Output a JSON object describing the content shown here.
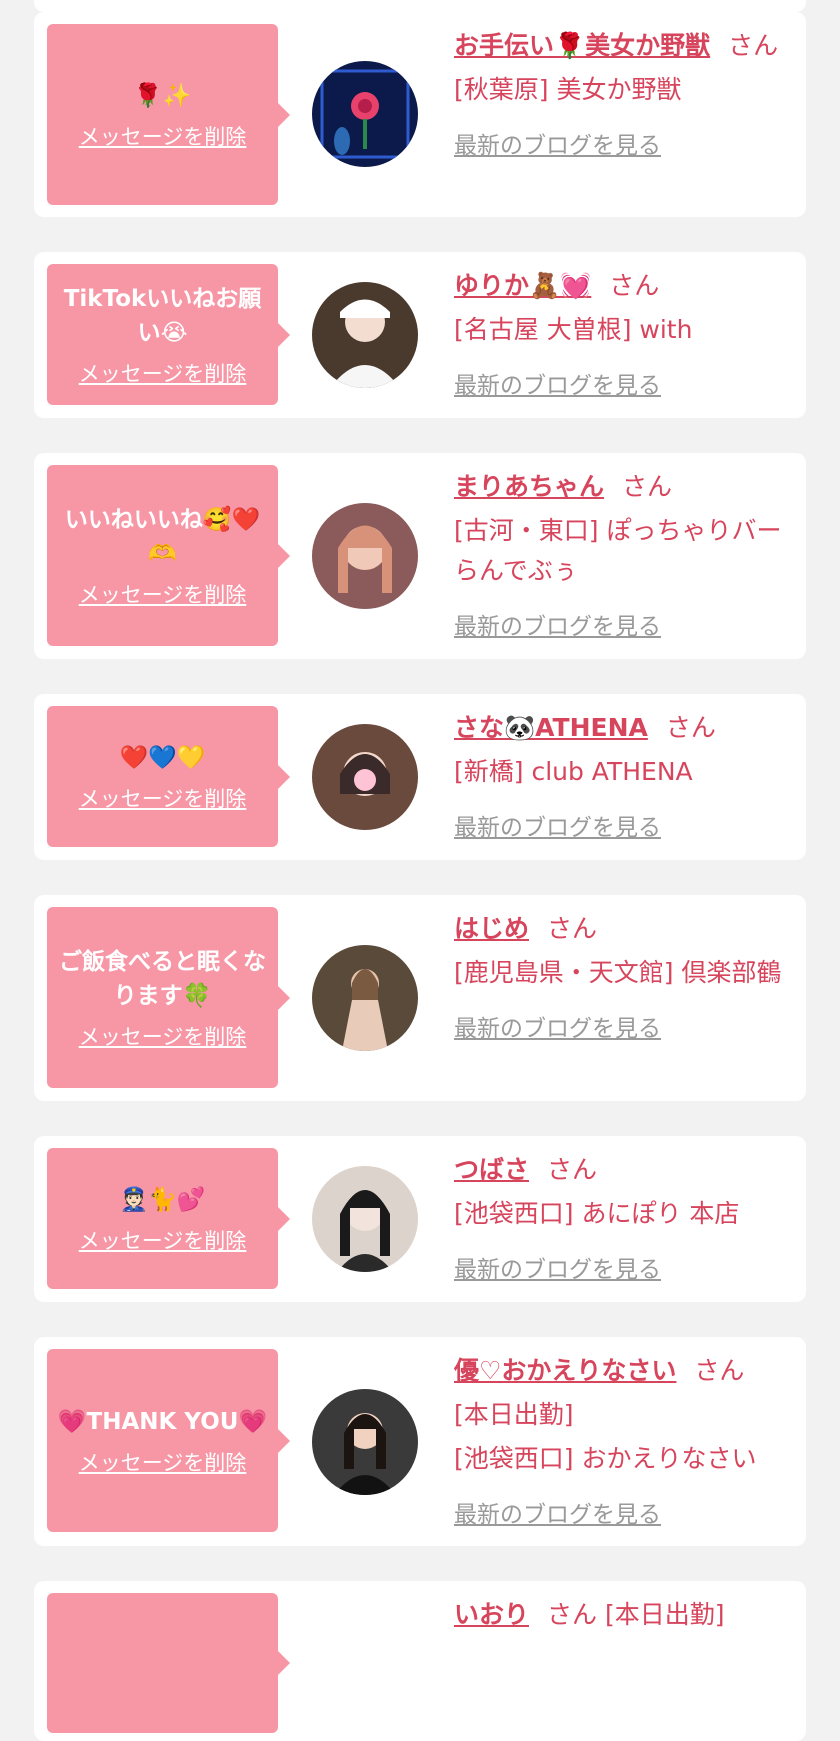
{
  "delete_label": "メッセージを削除",
  "san_label": "さん",
  "blog_link_label": "最新のブログを見る",
  "colors": {
    "bubble": "#f797a6",
    "name": "#d7455d",
    "link_gray": "#999999",
    "background": "#f2f2f2"
  },
  "entries": [
    {
      "message": "🌹✨",
      "name": "お手伝い🌹美女か野獣",
      "shop_lines": [
        "[秋葉原] 美女か野獣"
      ],
      "avatar": "rose-avatar"
    },
    {
      "message": "TikTokいいねお願い😭",
      "name": "ゆりか🧸💓",
      "shop_lines": [
        "[名古屋 大曽根] with"
      ],
      "avatar": "woman-avatar"
    },
    {
      "message": "いいねいいね🥰❤️🫶",
      "name": "まりあちゃん",
      "shop_lines": [
        "[古河・東口] ぽっちゃりバー らんでぶぅ"
      ],
      "avatar": "woman-avatar"
    },
    {
      "message": "❤️💙💛",
      "name": "さな🐼ATHENA",
      "shop_lines": [
        "[新橋] club ATHENA"
      ],
      "avatar": "woman-avatar"
    },
    {
      "message": "ご飯食べると眠くなります🍀",
      "name": "はじめ",
      "shop_lines": [
        "[鹿児島県・天文館] 倶楽部鶴"
      ],
      "avatar": "woman-avatar"
    },
    {
      "message": "👮🏻🐈💕",
      "name": "つばさ",
      "shop_lines": [
        "[池袋西口] あにぽり 本店"
      ],
      "avatar": "woman-avatar"
    },
    {
      "message": "💗THANK YOU💗",
      "name": "優♡おかえりなさい",
      "shop_lines": [
        "[本日出勤]",
        "[池袋西口] おかえりなさい"
      ],
      "avatar": "woman-avatar"
    },
    {
      "message": "",
      "name": "いおり",
      "shop_lines": [
        "[本日出勤]"
      ],
      "avatar": "woman-avatar"
    }
  ]
}
